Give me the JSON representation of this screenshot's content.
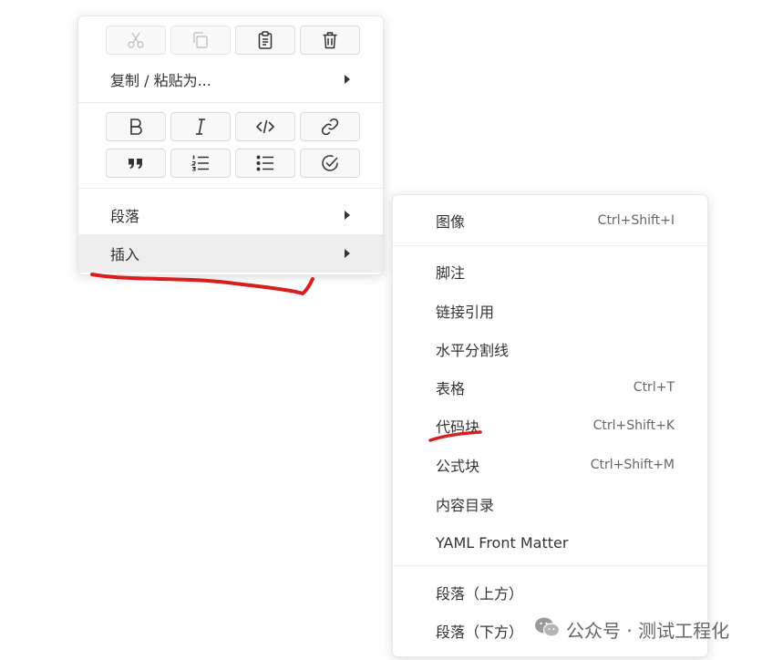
{
  "context_menu": {
    "toolbar_row1": [
      {
        "name": "cut",
        "icon": "scissors-icon",
        "disabled": true
      },
      {
        "name": "copy",
        "icon": "copy-icon",
        "disabled": true
      },
      {
        "name": "paste",
        "icon": "clipboard-icon",
        "disabled": false
      },
      {
        "name": "delete",
        "icon": "trash-icon",
        "disabled": false
      }
    ],
    "copy_paste_as_label": "复制 / 粘贴为...",
    "format_row1": [
      {
        "name": "bold",
        "icon": "bold-icon"
      },
      {
        "name": "italic",
        "icon": "italic-icon"
      },
      {
        "name": "code",
        "icon": "code-icon"
      },
      {
        "name": "link",
        "icon": "link-icon"
      }
    ],
    "format_row2": [
      {
        "name": "quote",
        "icon": "quote-icon"
      },
      {
        "name": "ordered-list",
        "icon": "ordered-list-icon"
      },
      {
        "name": "unordered-list",
        "icon": "unordered-list-icon"
      },
      {
        "name": "task-list",
        "icon": "check-circle-icon"
      }
    ],
    "paragraph_label": "段落",
    "insert_label": "插入"
  },
  "insert_submenu": {
    "image": {
      "label": "图像",
      "shortcut": "Ctrl+Shift+I"
    },
    "footnote": {
      "label": "脚注"
    },
    "link_reference": {
      "label": "链接引用"
    },
    "horizontal_rule": {
      "label": "水平分割线"
    },
    "table": {
      "label": "表格",
      "shortcut": "Ctrl+T"
    },
    "code_block": {
      "label": "代码块",
      "shortcut": "Ctrl+Shift+K"
    },
    "math_block": {
      "label": "公式块",
      "shortcut": "Ctrl+Shift+M"
    },
    "toc": {
      "label": "内容目录"
    },
    "yaml_front_matter": {
      "label": "YAML Front Matter"
    },
    "paragraph_above": {
      "label": "段落（上方）"
    },
    "paragraph_below": {
      "label": "段落（下方）"
    }
  },
  "watermark": {
    "text": "公众号 · 测试工程化",
    "icon": "wechat-icon"
  },
  "colors": {
    "annotation_red": "#d81e1e",
    "active_item_bg": "#eeeeee",
    "menu_border": "#e8e8e8"
  }
}
